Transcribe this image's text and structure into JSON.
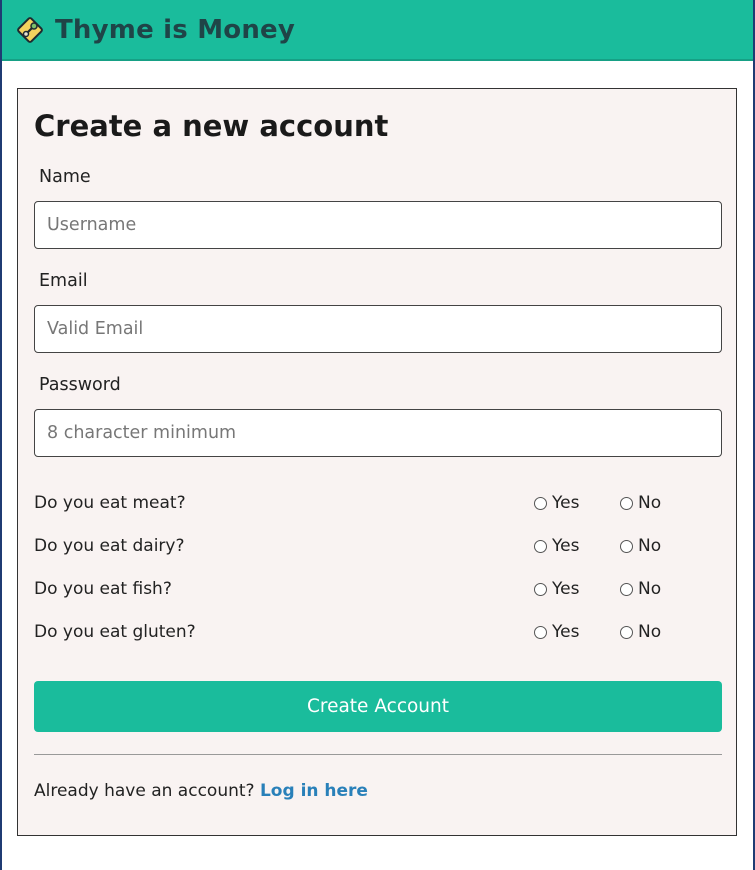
{
  "header": {
    "brand": "Thyme is Money",
    "logo_icon": "herb-logo-icon",
    "background_color": "#1abc9c"
  },
  "form": {
    "title": "Create a new account",
    "name": {
      "label": "Name",
      "placeholder": "Username"
    },
    "email": {
      "label": "Email",
      "placeholder": "Valid Email"
    },
    "password": {
      "label": "Password",
      "placeholder": "8 character minimum"
    },
    "questions": [
      {
        "text": "Do you eat meat?",
        "yes": "Yes",
        "no": "No"
      },
      {
        "text": "Do you eat dairy?",
        "yes": "Yes",
        "no": "No"
      },
      {
        "text": "Do you eat fish?",
        "yes": "Yes",
        "no": "No"
      },
      {
        "text": "Do you eat gluten?",
        "yes": "Yes",
        "no": "No"
      }
    ],
    "submit_label": "Create Account",
    "login_prompt": "Already have an account? ",
    "login_link": "Log in here",
    "accent_color": "#1abc9c",
    "link_color": "#2980b9"
  }
}
